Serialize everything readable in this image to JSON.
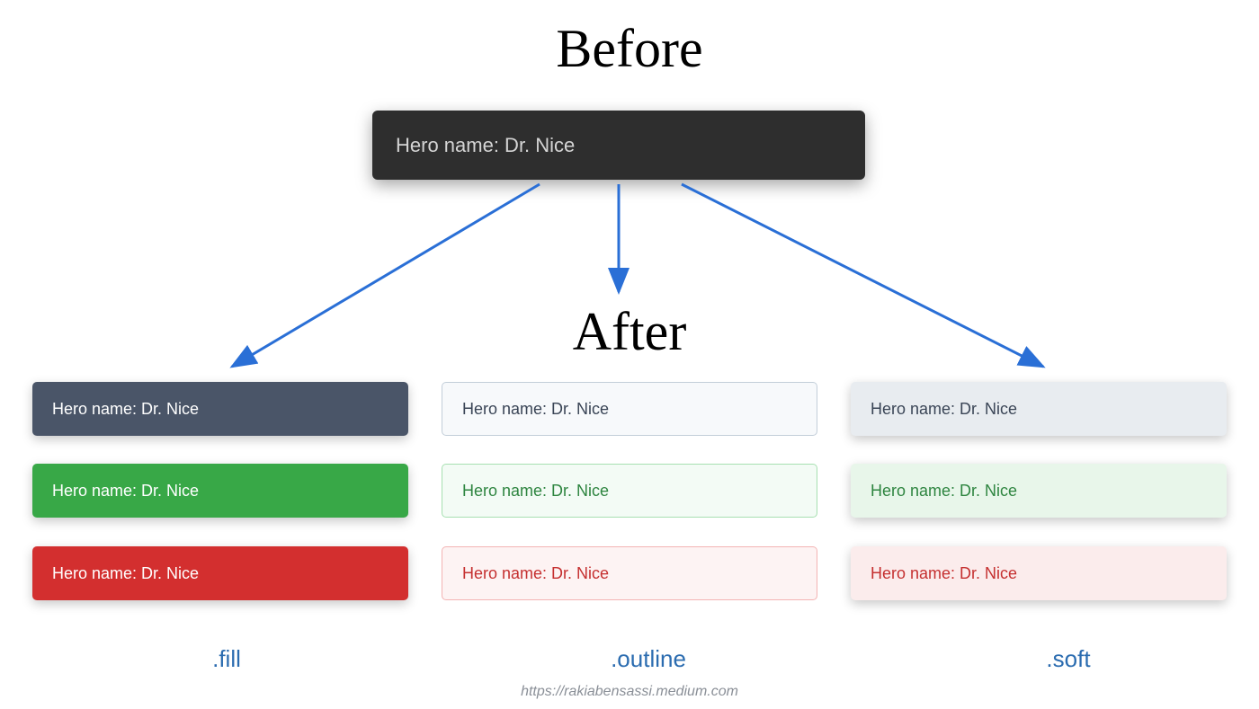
{
  "headings": {
    "before": "Before",
    "after": "After"
  },
  "before_card": {
    "text": "Hero name: Dr. Nice"
  },
  "variants": {
    "fill": {
      "label": ".fill",
      "dark": "Hero name: Dr. Nice",
      "green": "Hero name: Dr. Nice",
      "red": "Hero name: Dr. Nice"
    },
    "outline": {
      "label": ".outline",
      "dark": "Hero name: Dr. Nice",
      "green": "Hero name: Dr. Nice",
      "red": "Hero name: Dr. Nice"
    },
    "soft": {
      "label": ".soft",
      "dark": "Hero name: Dr. Nice",
      "green": "Hero name: Dr. Nice",
      "red": "Hero name: Dr. Nice"
    }
  },
  "footer": "https://rakiabensassi.medium.com",
  "colors": {
    "arrow": "#2a6fd6",
    "fill_dark": "#4a5568",
    "fill_green": "#38a847",
    "fill_red": "#d32f2f",
    "variant_label": "#2b6cb0"
  }
}
